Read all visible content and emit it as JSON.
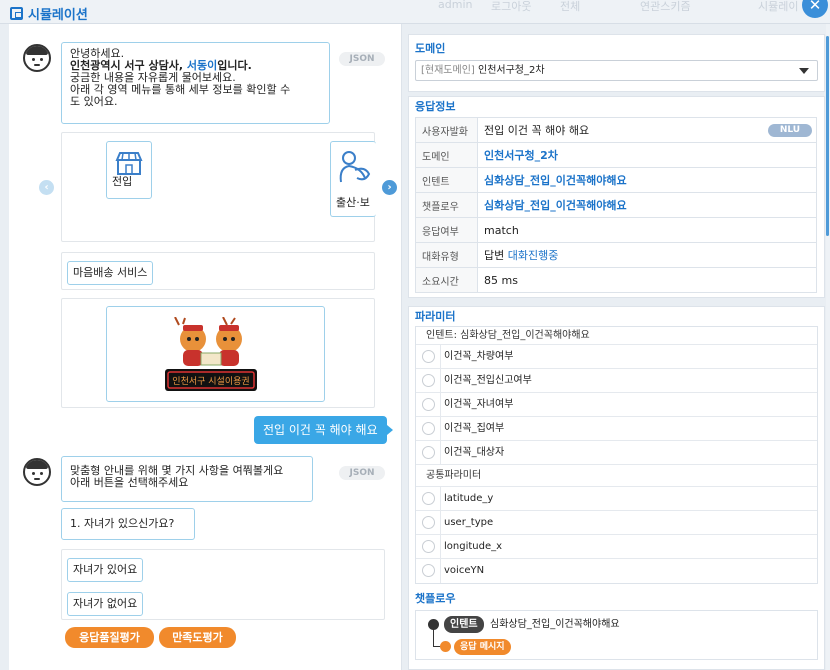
{
  "window": {
    "title": "시뮬레이션",
    "user": "admin",
    "logout": "로그아웃",
    "menu": "전체",
    "btn_left": "연관스키즘",
    "btn_right": "시뮬레이"
  },
  "chat": {
    "bot1": {
      "line1": "안녕하세요.",
      "line2_pre": "인천광역시 서구 상담사, ",
      "line2_name": "서동이",
      "line2_post": "입니다.",
      "line3": "궁금한 내용을 자유롭게 물어보세요.",
      "line4": "아래 각 영역 메뉴를 통해 세부 정보를 확인할 수",
      "line5": "도 있어요.",
      "json_tag": "JSON"
    },
    "carousel": [
      "전입",
      "출산·보"
    ],
    "btn_maeum": "마음배송 서비스",
    "banner_text": "인천서구 시설이용권",
    "user_msg": "전입 이건 꼭 해야 해요",
    "bot2": {
      "line1": "맞춤형 안내를 위해 몇 가지 사항을 여쭤볼게요",
      "line2": "아래 버튼을 선택해주세요",
      "json_tag": "JSON",
      "question": "1. 자녀가 있으신가요?",
      "options": [
        "자녀가 있어요",
        "자녀가 없어요"
      ]
    },
    "eval_buttons": [
      "응답품질평가",
      "만족도평가"
    ]
  },
  "domain": {
    "title": "도메인",
    "tag": "[현재도메인]",
    "value": "인천서구청_2차"
  },
  "response": {
    "title": "응답정보",
    "rows": [
      {
        "key": "사용자발화",
        "value": "전입 이건 꼭 해야 해요",
        "badge": "NLU"
      },
      {
        "key": "도메인",
        "value": "인천서구청_2차"
      },
      {
        "key": "인텐트",
        "value": "심화상담_전입_이건꼭해야해요"
      },
      {
        "key": "챗플로우",
        "value": "심화상담_전입_이건꼭해야해요"
      },
      {
        "key": "응답여부",
        "value": "match"
      },
      {
        "key": "대화유형",
        "value": "답변",
        "value2": "대화진행중"
      },
      {
        "key": "소요시간",
        "value": "85 ms"
      }
    ]
  },
  "params": {
    "title": "파라미터",
    "intent_head": "인텐트: 심화상담_전입_이건꼭해야해요",
    "intent_params": [
      "이건꼭_차량여부",
      "이건꼭_전입신고여부",
      "이건꼭_자녀여부",
      "이건꼭_집여부",
      "이건꼭_대상자"
    ],
    "common_head": "공통파라미터",
    "common_params": [
      "latitude_y",
      "user_type",
      "longitude_x",
      "voiceYN"
    ]
  },
  "chatflow": {
    "title": "챗플로우",
    "intent_badge": "인텐트",
    "intent_value": "심화상담_전입_이건꼭해야해요",
    "resp_badge": "응답 메시지"
  },
  "colors": {
    "accent": "#1b73c9",
    "bubble_user": "#3aa7e6",
    "orange": "#f18a2c"
  }
}
